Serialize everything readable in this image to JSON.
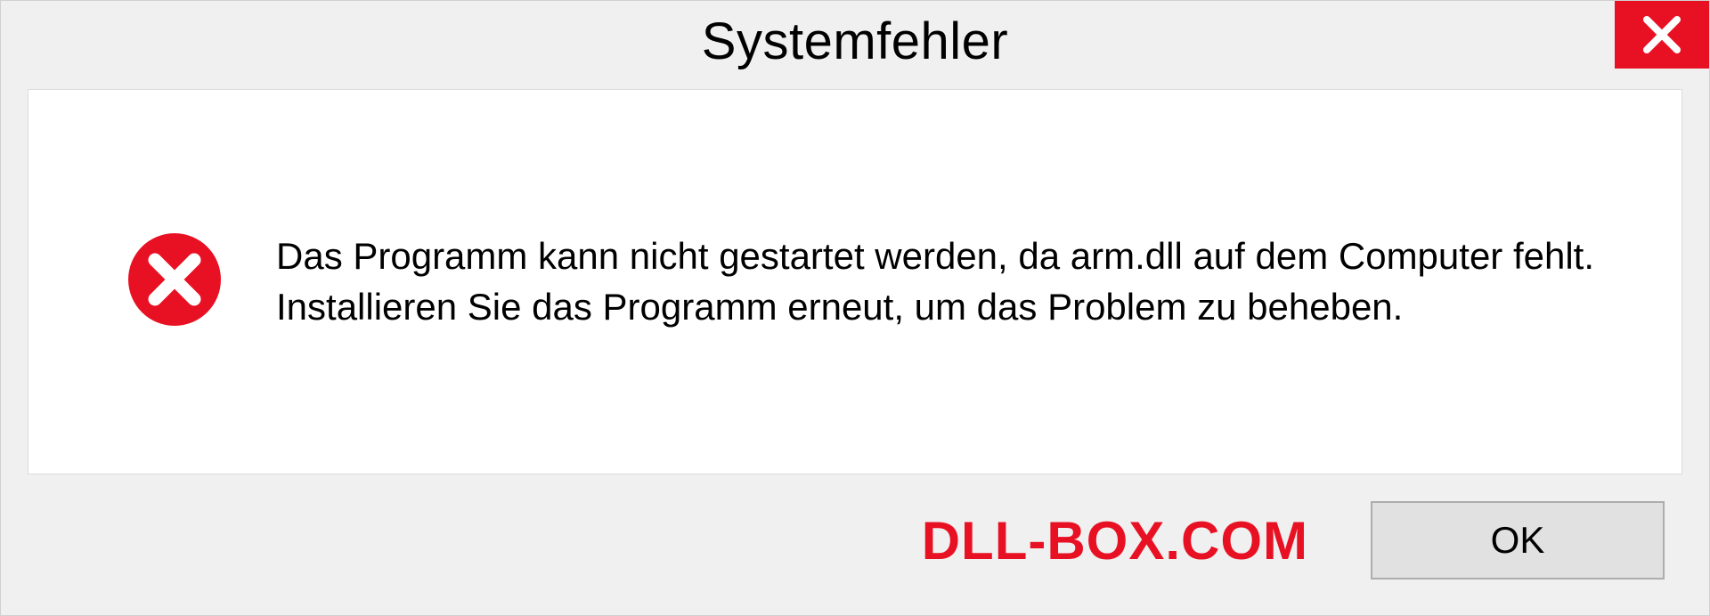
{
  "dialog": {
    "title": "Systemfehler",
    "message": "Das Programm kann nicht gestartet werden, da arm.dll auf dem Computer fehlt. Installieren Sie das Programm erneut, um das Problem zu beheben.",
    "ok_label": "OK"
  },
  "watermark": "DLL-BOX.COM"
}
